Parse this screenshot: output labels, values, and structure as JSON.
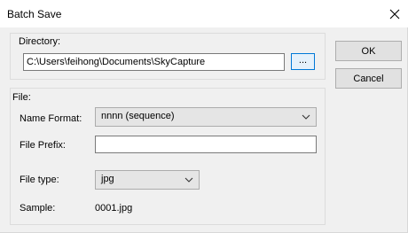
{
  "window": {
    "title": "Batch Save"
  },
  "directory": {
    "group_label": "Directory:",
    "path_value": "C:\\Users\\feihong\\Documents\\SkyCapture",
    "browse_label": "..."
  },
  "file": {
    "group_label": "File:",
    "name_format_label": "Name Format:",
    "name_format_value": "nnnn (sequence)",
    "file_prefix_label": "File Prefix:",
    "file_prefix_value": "",
    "file_type_label": "File type:",
    "file_type_value": "jpg",
    "sample_label": "Sample:",
    "sample_value": "0001.jpg"
  },
  "buttons": {
    "ok": "OK",
    "cancel": "Cancel"
  }
}
